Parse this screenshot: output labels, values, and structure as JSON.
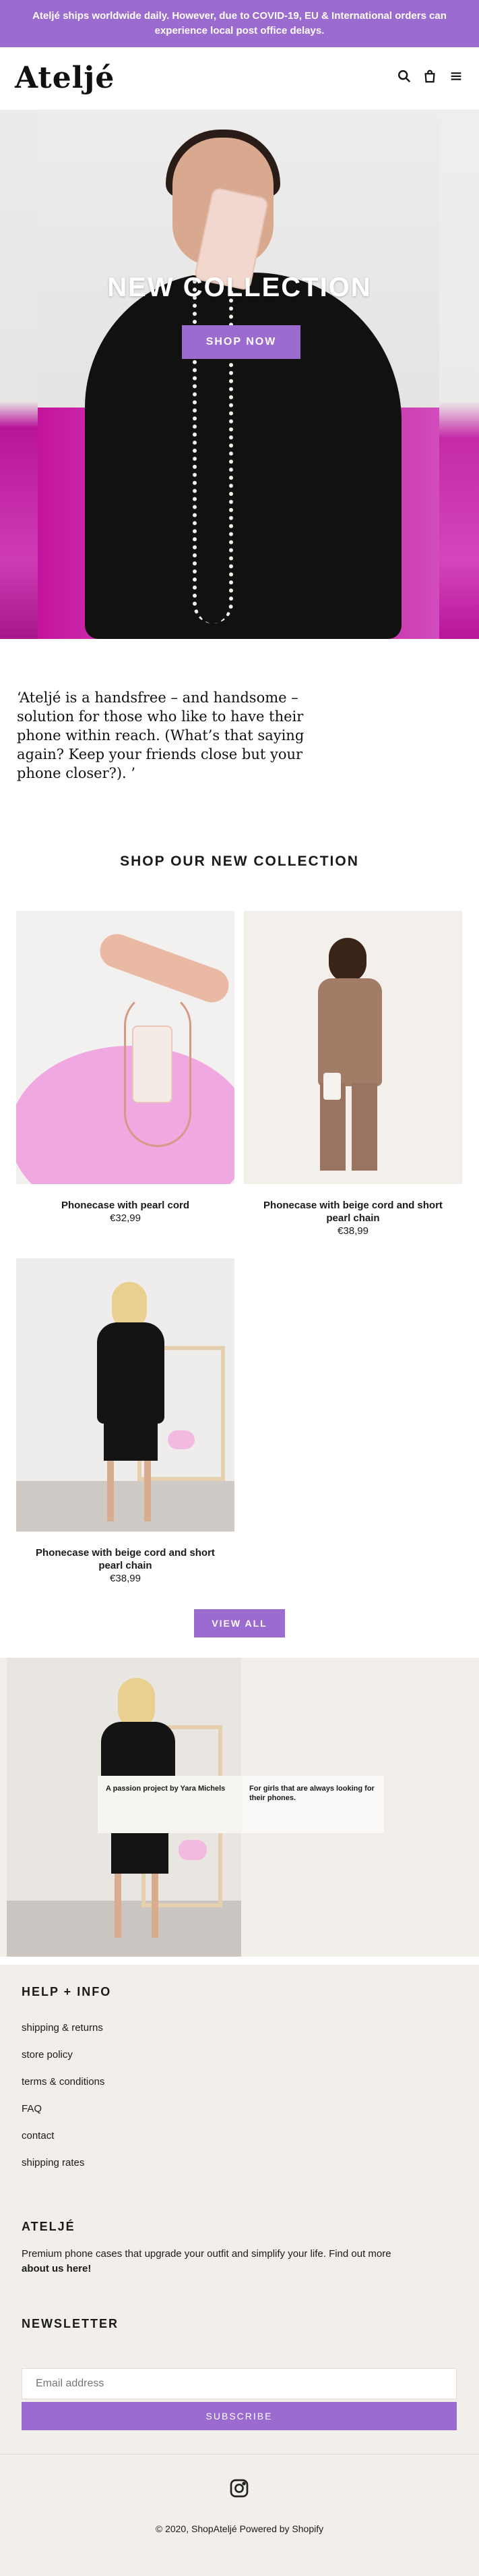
{
  "announcement": "Ateljé ships worldwide daily. However, due to COVID-19, EU & International orders can experience local post office delays.",
  "header": {
    "logo": "Ateljé",
    "icons": [
      "search-icon",
      "cart-icon",
      "menu-icon"
    ]
  },
  "hero": {
    "title": "NEW COLLECTION",
    "button": "SHOP NOW"
  },
  "intro": "‘Ateljé is a handsfree – and handsome – solution for those who like to have their phone within reach. (What’s that saying again? Keep your friends close but your phone closer?). ’",
  "collection": {
    "title": "SHOP OUR NEW COLLECTION",
    "products": [
      {
        "name": "Phonecase with pearl cord",
        "price": "€32,99"
      },
      {
        "name": "Phonecase with beige cord and short pearl chain",
        "price": "€38,99"
      },
      {
        "name": "Phonecase with beige cord and short pearl chain",
        "price": "€38,99"
      }
    ],
    "view_all": "VIEW ALL"
  },
  "feature": {
    "card1": "A passion project by Yara Michels",
    "card2": "For girls that are always looking for their phones."
  },
  "footer": {
    "help_title": "HELP + INFO",
    "links": [
      "shipping & returns",
      "store policy",
      "terms & conditions",
      "FAQ",
      "contact",
      "shipping rates"
    ],
    "about_title": "ATELJÉ",
    "about_text": "Premium phone cases that upgrade your outfit and simplify your life. Find out more",
    "about_link": "about us here!",
    "newsletter_title": "NEWSLETTER",
    "email_placeholder": "Email address",
    "subscribe": "SUBSCRIBE",
    "copyright": "© 2020, ShopAteljé Powered by Shopify"
  },
  "colors": {
    "accent": "#9b6bcf",
    "footer_bg": "#f2efea"
  }
}
